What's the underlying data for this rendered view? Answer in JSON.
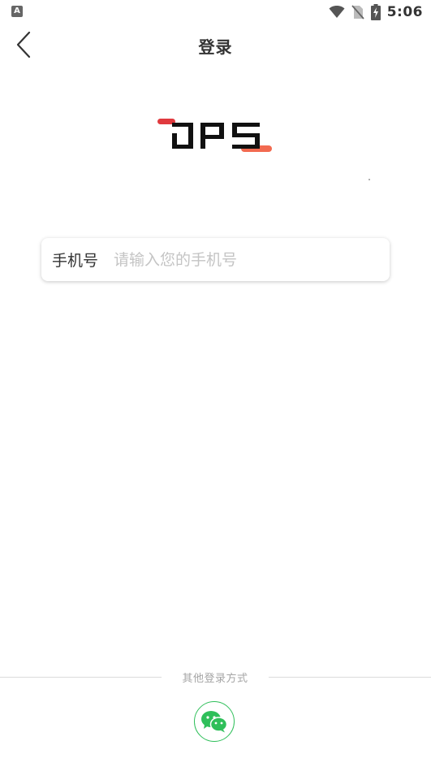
{
  "status_bar": {
    "left_icon": "A",
    "time": "5:06",
    "icons": [
      "wifi-icon",
      "no-sim-icon",
      "battery-charging-icon"
    ]
  },
  "nav": {
    "title": "登录",
    "back_icon": "chevron-left-icon"
  },
  "logo": {
    "text": "DPS",
    "colors": {
      "red": "#e03a3e",
      "orange": "#f26a50",
      "black": "#111111"
    }
  },
  "form": {
    "phone_label": "手机号",
    "phone_value": "",
    "phone_placeholder": "请输入您的手机号"
  },
  "other_login": {
    "label": "其他登录方式",
    "wechat_icon": "wechat-icon",
    "wechat_color": "#2fbf5a"
  }
}
